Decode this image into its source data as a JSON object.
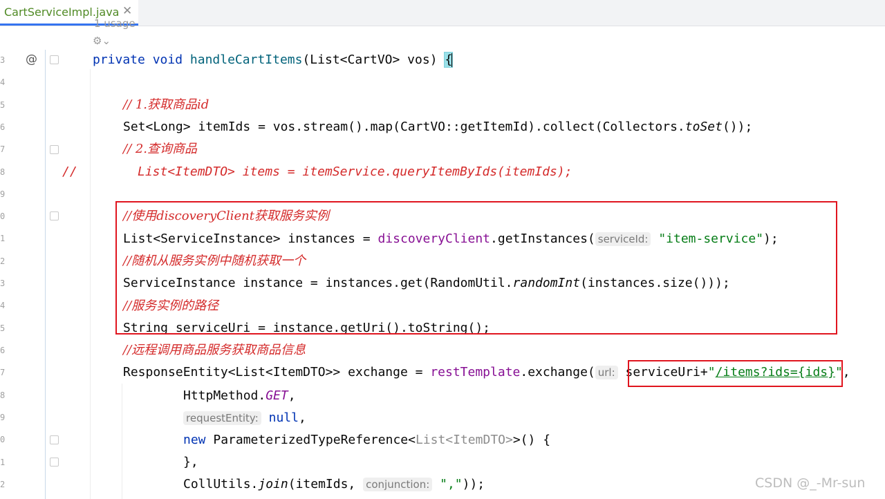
{
  "tab": {
    "filename": "CartServiceImpl.java",
    "close": "✕"
  },
  "usage": {
    "label": "1 usage",
    "icon_text": "⚙⌄"
  },
  "gutter": {
    "at_symbol": "@",
    "line_numbers": [
      "3",
      "4",
      "5",
      "6",
      "7",
      "8",
      "9",
      "0",
      "1",
      "2",
      "3",
      "4",
      "5",
      "6",
      "7",
      "8",
      "9",
      "0",
      "1",
      "2"
    ]
  },
  "code": {
    "l1": {
      "kw1": "private",
      "kw2": "void",
      "fn": "handleCartItems",
      "rest": "(List<CartVO> vos) ",
      "brace": "{"
    },
    "l2": {
      "comment": "// 1.获取商品id"
    },
    "l3": {
      "a": "Set<Long> itemIds = vos.stream().map(CartVO::getItemId).collect(Collectors.",
      "b": "toSet",
      "c": "());"
    },
    "l4": {
      "comment": "// 2.查询商品"
    },
    "l5": {
      "prefix": "//",
      "comment": "List<ItemDTO> items = itemService.queryItemByIds(itemIds);"
    },
    "l6": {
      "comment": "//使用discoveryClient获取服务实例"
    },
    "l7": {
      "a": "List<ServiceInstance> instances = ",
      "field": "discoveryClient",
      "b": ".getInstances(",
      "hint": "serviceId:",
      "str": "\"item-service\"",
      "c": ");"
    },
    "l8": {
      "comment": "//随机从服务实例中随机获取一个"
    },
    "l9": {
      "a": "ServiceInstance instance = instances.get(RandomUtil.",
      "b": "randomInt",
      "c": "(instances.size()));"
    },
    "l10": {
      "comment": "//服务实例的路径"
    },
    "l11": {
      "a": "String serviceUri = instance.getUri().toString();"
    },
    "l12": {
      "comment": "//远程调用商品服务获取商品信息"
    },
    "l13": {
      "a": "ResponseEntity<List<ItemDTO>> exchange = ",
      "field": "restTemplate",
      "b": ".exchange(",
      "hint": "url:",
      "c": "serviceUri+",
      "q1": "\"",
      "url": "/items?ids={ids}",
      "q2": "\"",
      "d": ","
    },
    "l14": {
      "a": "HttpMethod.",
      "b": "GET",
      "c": ","
    },
    "l15": {
      "hint": "requestEntity:",
      "kw": "null",
      "c": ","
    },
    "l16": {
      "kw": "new",
      "a": " ParameterizedTypeReference<",
      "b": "List<ItemDTO>",
      "c": ">() {"
    },
    "l17": {
      "a": "},"
    },
    "l18": {
      "a": "CollUtils.",
      "b": "join",
      "c": "(itemIds, ",
      "hint": "conjunction:",
      "str": "\",\"",
      "d": "));"
    }
  },
  "watermark": "CSDN @_-Mr-sun"
}
